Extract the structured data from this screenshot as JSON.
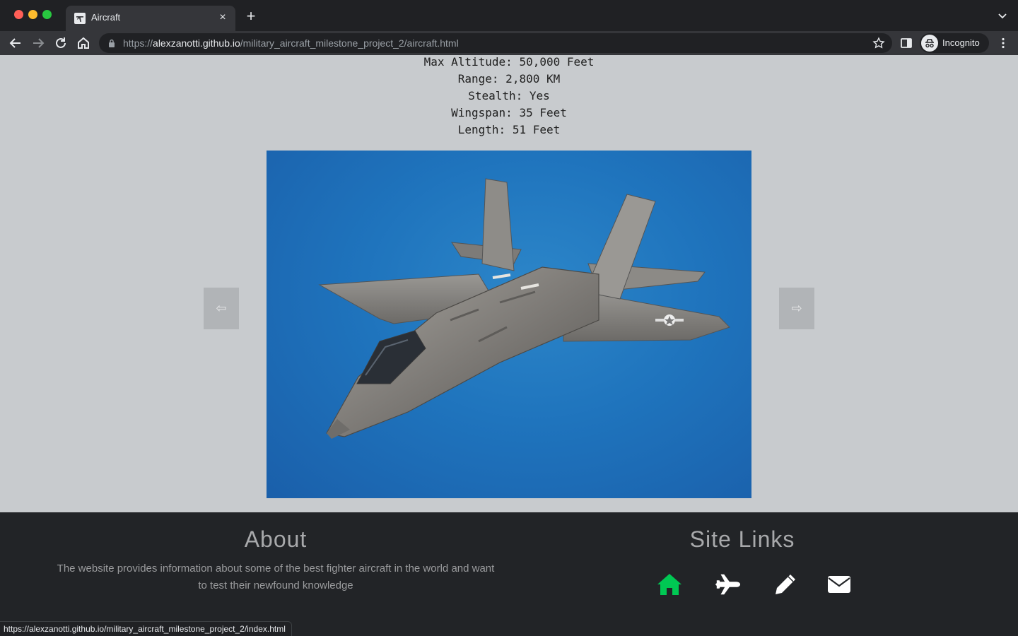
{
  "browser": {
    "tab_title": "Aircraft",
    "tab_close": "×",
    "new_tab": "+",
    "url_scheme": "https://",
    "url_host": "alexzanotti.github.io",
    "url_path": "/military_aircraft_milestone_project_2/aircraft.html",
    "profile_label": "Incognito"
  },
  "specs": [
    "Max Altitude: 50,000 Feet",
    "Range: 2,800 KM",
    "Stealth: Yes",
    "Wingspan: 35 Feet",
    "Length: 51 Feet"
  ],
  "carousel": {
    "prev_glyph": "⇦",
    "next_glyph": "⇨",
    "image_subject": "F-35 fighter jet in flight over blue sky"
  },
  "footer": {
    "about_title": "About",
    "about_text": "The website provides information about some of the best fighter aircraft in the world and want to test their newfound knowledge",
    "links_title": "Site Links",
    "links": [
      {
        "icon": "home-icon",
        "color": "#00c853"
      },
      {
        "icon": "plane-icon",
        "color": "#ffffff"
      },
      {
        "icon": "pencil-icon",
        "color": "#ffffff"
      },
      {
        "icon": "envelope-icon",
        "color": "#ffffff"
      }
    ]
  },
  "status_bar": {
    "hover_url": "https://alexzanotti.github.io/military_aircraft_milestone_project_2/index.html"
  },
  "colors": {
    "page_bg": "#c8cbce",
    "footer_bg": "#222427",
    "active_link": "#00c853"
  }
}
